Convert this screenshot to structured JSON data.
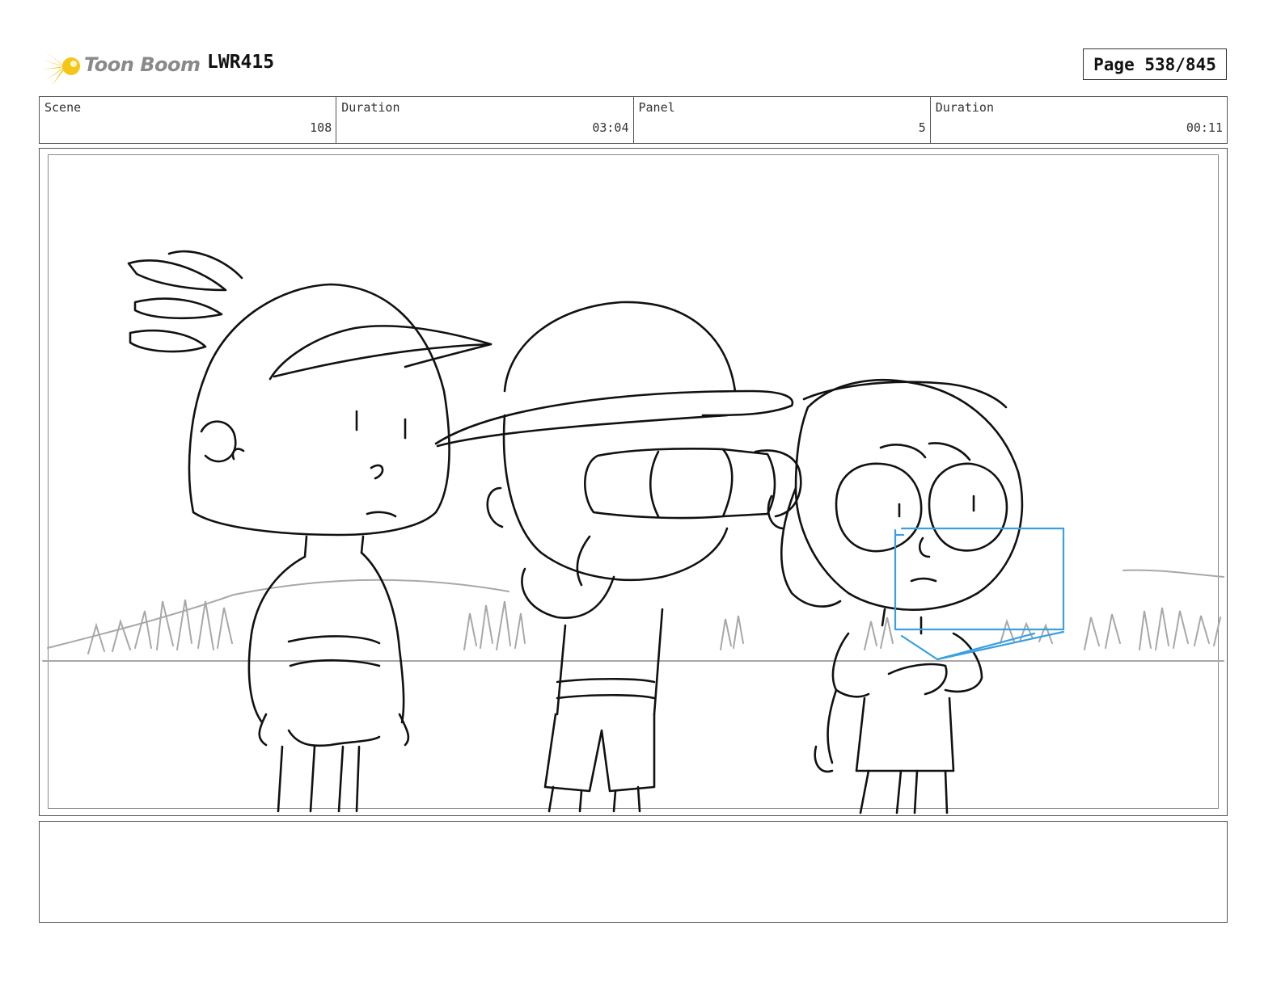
{
  "header": {
    "logo_text": "Toon Boom",
    "production_code": "LWR415",
    "page_label": "Page 538/845"
  },
  "info": [
    {
      "label": "Scene",
      "value": "108"
    },
    {
      "label": "Duration",
      "value": "03:04"
    },
    {
      "label": "Panel",
      "value": "5"
    },
    {
      "label": "Duration",
      "value": "00:11"
    }
  ],
  "colors": {
    "logo_star": "#f5c518",
    "camera_guide": "#3aa0e0",
    "background_sketch": "#a8a8a8",
    "line_art": "#111111"
  },
  "notes": ""
}
